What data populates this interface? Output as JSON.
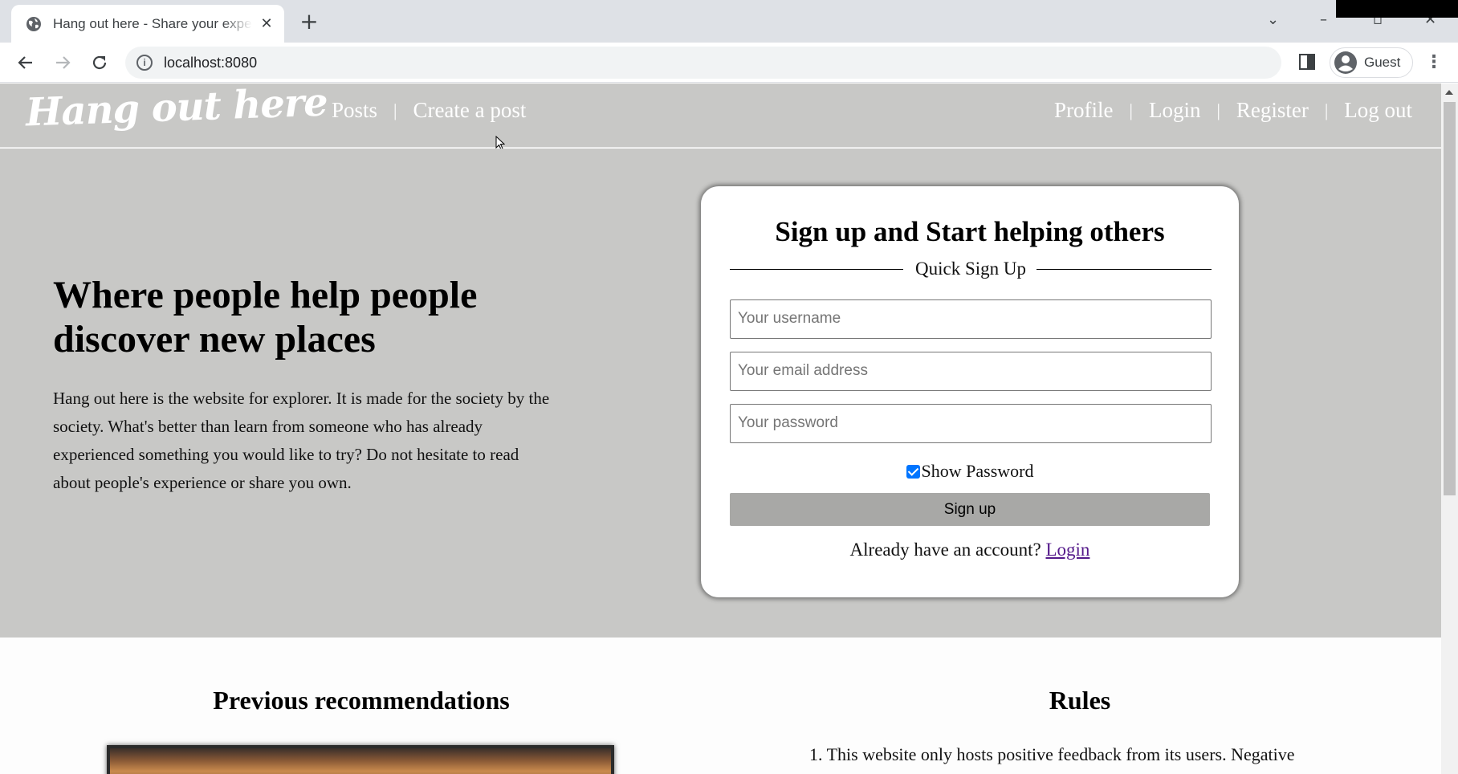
{
  "browser": {
    "tab_title": "Hang out here - Share your experiences",
    "url": "localhost:8080",
    "profile_label": "Guest"
  },
  "site": {
    "logo": "Hang out here",
    "nav_left": [
      "Posts",
      "Create a post"
    ],
    "nav_right": [
      "Profile",
      "Login",
      "Register",
      "Log out"
    ],
    "nav_separator": "|"
  },
  "hero": {
    "heading": "Where people help people discover new places",
    "description": "Hang out here is the website for explorer. It is made for the society by the society. What's better than learn from someone who has already experienced something you would like to try? Do not hesitate to read about people's experience or share you own."
  },
  "signup": {
    "title": "Sign up and Start helping others",
    "divider_label": "Quick Sign Up",
    "username_placeholder": "Your username",
    "email_placeholder": "Your email address",
    "password_placeholder": "Your password",
    "show_password_label": "Show Password",
    "show_password_checked": true,
    "submit_label": "Sign up",
    "already_text": "Already have an account?",
    "login_link": "Login"
  },
  "sections": {
    "recommendations_title": "Previous recommendations",
    "rules_title": "Rules",
    "rule_1_partial": "1. This website only hosts positive feedback from its users. Negative"
  },
  "colors": {
    "header_bg": "#c8c8c6",
    "accent_checkbox": "#0075ff",
    "button_bg": "#a8a8a6",
    "link_visited": "#551a8b"
  }
}
